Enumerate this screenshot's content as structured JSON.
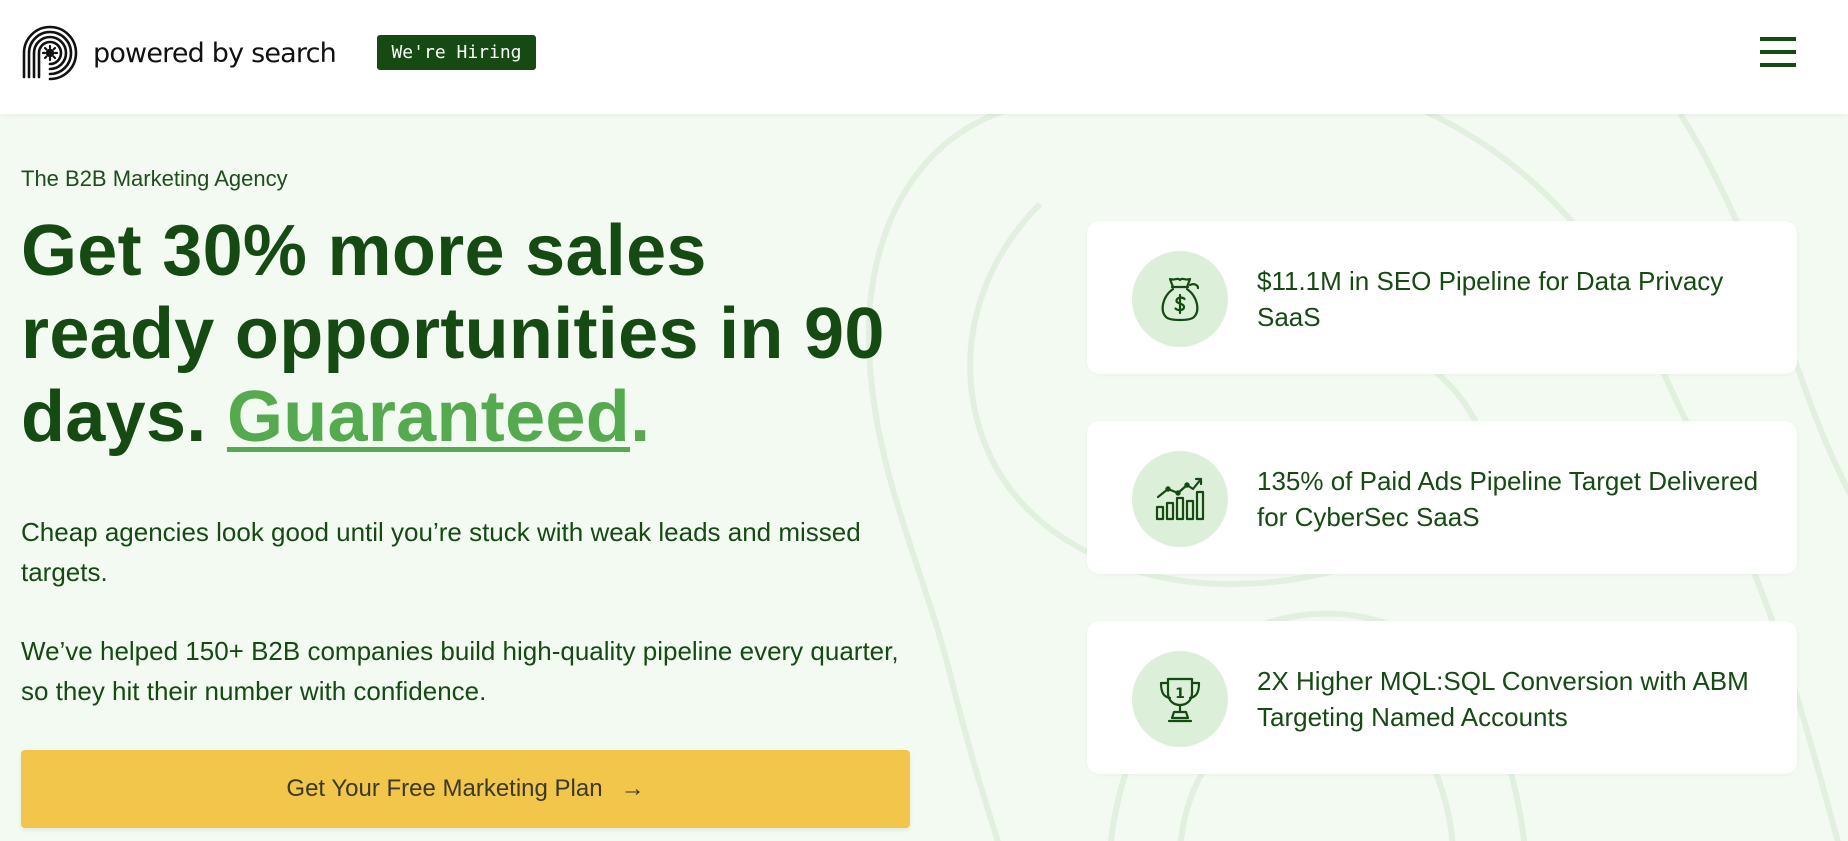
{
  "header": {
    "logo_text": "powered by search",
    "hiring_label": "We're Hiring"
  },
  "hero": {
    "eyebrow": "The B2B Marketing Agency",
    "headline_main": "Get 30% more sales ready opportunities in 90 days.",
    "headline_accent": "Guaranteed",
    "headline_end": ".",
    "paragraph1": "Cheap agencies look good until you’re stuck with weak leads and missed targets.",
    "paragraph2": "We’ve helped 150+ B2B companies build high-quality pipeline every quarter, so they hit their number with confidence.",
    "cta_label": "Get Your Free Marketing Plan",
    "cta_icon": "→"
  },
  "stats": [
    {
      "icon": "money-bag-icon",
      "text": "$11.1M in SEO Pipeline for Data Privacy SaaS"
    },
    {
      "icon": "growth-chart-icon",
      "text": "135% of Paid Ads Pipeline Target Delivered for CyberSec SaaS"
    },
    {
      "icon": "trophy-icon",
      "text": "2X Higher MQL:SQL Conversion with ABM Targeting Named Accounts"
    }
  ],
  "trophy_number": "1",
  "colors": {
    "brand_green": "#154a12",
    "accent_green": "#55a94f",
    "cta_yellow": "#f2c54b",
    "icon_bg": "#dcefd9",
    "page_bg": "#f3faf2"
  }
}
